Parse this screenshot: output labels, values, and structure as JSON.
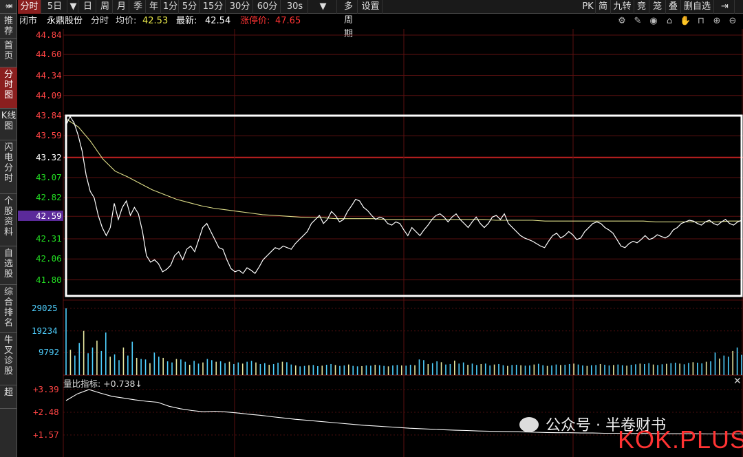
{
  "left_nav": {
    "expand_glyph": "»",
    "items": [
      {
        "label": "推荐",
        "active": false
      },
      {
        "label": "首页",
        "active": false
      },
      {
        "label": "分时图",
        "active": true
      },
      {
        "label": "K线图",
        "active": false
      },
      {
        "label": "闪电分时",
        "active": false
      },
      {
        "label": "个股资料",
        "active": false
      },
      {
        "label": "自选股",
        "active": false
      },
      {
        "label": "综合排名",
        "active": false
      },
      {
        "label": "牛叉诊股",
        "active": false
      },
      {
        "label": "超",
        "active": false
      }
    ]
  },
  "toolbar": {
    "left": [
      {
        "label": "分时",
        "active": true
      },
      {
        "label": "5日",
        "active": false
      },
      {
        "label": "▼",
        "active": false
      },
      {
        "label": "日",
        "active": false
      },
      {
        "label": "周",
        "active": false
      },
      {
        "label": "月",
        "active": false
      },
      {
        "label": "季",
        "active": false
      },
      {
        "label": "年",
        "active": false
      },
      {
        "label": "1分",
        "active": false
      },
      {
        "label": "5分",
        "active": false
      },
      {
        "label": "15分",
        "active": false
      },
      {
        "label": "30分",
        "active": false
      },
      {
        "label": "60分",
        "active": false
      },
      {
        "label": "30s",
        "active": false
      },
      {
        "label": "▼",
        "active": false
      },
      {
        "label": "多周期",
        "active": false
      },
      {
        "label": "设置",
        "active": false
      }
    ],
    "right": [
      "PK",
      "简",
      "九转",
      "竞",
      "笼",
      "叠",
      "删自选"
    ]
  },
  "info": {
    "status": "闭市",
    "name": "永鼎股份",
    "view": "分时",
    "avg_label": "均价:",
    "avg_value": "42.53",
    "last_label": "最新:",
    "last_value": "42.54",
    "limit_label": "涨停价:",
    "limit_value": "47.65"
  },
  "header_icons": [
    "settings-icon",
    "pen-icon",
    "eye-icon",
    "basket-icon",
    "hand-icon",
    "lock-icon",
    "zoom-in-icon",
    "zoom-out-icon"
  ],
  "price_axis": {
    "labels": [
      {
        "text": "44.84",
        "color": "#ff4444"
      },
      {
        "text": "44.60",
        "color": "#ff4444"
      },
      {
        "text": "44.34",
        "color": "#ff4444"
      },
      {
        "text": "44.09",
        "color": "#ff4444"
      },
      {
        "text": "43.84",
        "color": "#ff4444"
      },
      {
        "text": "43.59",
        "color": "#ff4444"
      },
      {
        "text": "43.32",
        "color": "#ffffff"
      },
      {
        "text": "43.07",
        "color": "#22dd22"
      },
      {
        "text": "42.82",
        "color": "#22dd22"
      },
      {
        "text": "42.59",
        "color": "#ffffff"
      },
      {
        "text": "42.31",
        "color": "#22dd22"
      },
      {
        "text": "42.06",
        "color": "#22dd22"
      },
      {
        "text": "41.80",
        "color": "#22dd22"
      }
    ],
    "highlight": "42.59"
  },
  "volume_axis": [
    "29025",
    "19234",
    "9792"
  ],
  "ratio_indicator": {
    "label": "量比指标: +0.738↓",
    "axis": [
      "+3.39",
      "+2.48",
      "+1.57"
    ]
  },
  "watermark": {
    "brand": "公众号 · 半卷财书",
    "site": "KOK.PLUS"
  },
  "chart_data": {
    "type": "line",
    "title": "",
    "y_range": [
      41.6,
      44.9
    ],
    "price": [
      43.72,
      43.83,
      43.75,
      43.6,
      43.4,
      43.1,
      42.9,
      42.82,
      42.6,
      42.45,
      42.35,
      42.45,
      42.75,
      42.55,
      42.7,
      42.78,
      42.6,
      42.7,
      42.62,
      42.4,
      42.1,
      42.02,
      42.05,
      42.0,
      41.9,
      41.93,
      41.98,
      42.1,
      42.15,
      42.05,
      42.18,
      42.22,
      42.15,
      42.3,
      42.45,
      42.5,
      42.4,
      42.3,
      42.2,
      42.18,
      42.05,
      41.94,
      41.9,
      41.92,
      41.88,
      41.95,
      41.92,
      41.88,
      41.96,
      42.05,
      42.1,
      42.15,
      42.2,
      42.18,
      42.22,
      42.2,
      42.18,
      42.25,
      42.3,
      42.35,
      42.4,
      42.5,
      42.55,
      42.6,
      42.5,
      42.55,
      42.65,
      42.6,
      42.52,
      42.55,
      42.65,
      42.72,
      42.8,
      42.78,
      42.7,
      42.66,
      42.6,
      42.55,
      42.58,
      42.56,
      42.5,
      42.48,
      42.52,
      42.5,
      42.42,
      42.35,
      42.45,
      42.4,
      42.35,
      42.42,
      42.48,
      42.55,
      42.6,
      42.62,
      42.58,
      42.52,
      42.58,
      42.62,
      42.55,
      42.5,
      42.45,
      42.52,
      42.58,
      42.5,
      42.45,
      42.5,
      42.58,
      42.6,
      42.55,
      42.62,
      42.5,
      42.45,
      42.4,
      42.35,
      42.32,
      42.3,
      42.28,
      42.25,
      42.22,
      42.2,
      42.28,
      42.35,
      42.38,
      42.32,
      42.35,
      42.4,
      42.36,
      42.3,
      42.32,
      42.4,
      42.45,
      42.5,
      42.52,
      42.5,
      42.45,
      42.42,
      42.38,
      42.3,
      42.22,
      42.2,
      42.25,
      42.28,
      42.26,
      42.3,
      42.35,
      42.3,
      42.32,
      42.36,
      42.34,
      42.32,
      42.35,
      42.42,
      42.45,
      42.5,
      42.52,
      42.54,
      42.53,
      42.5,
      42.48,
      42.52,
      42.54,
      42.5,
      42.48,
      42.52,
      42.55,
      42.5,
      42.48,
      42.52,
      42.54
    ],
    "average": [
      43.8,
      43.7,
      43.52,
      43.3,
      43.15,
      43.08,
      43.0,
      42.92,
      42.86,
      42.8,
      42.76,
      42.72,
      42.69,
      42.67,
      42.65,
      42.63,
      42.61,
      42.6,
      42.59,
      42.58,
      42.57,
      42.57,
      42.56,
      42.56,
      42.56,
      42.56,
      42.55,
      42.55,
      42.55,
      42.55,
      42.55,
      42.55,
      42.55,
      42.55,
      42.55,
      42.54,
      42.54,
      42.54,
      42.54,
      42.53,
      42.53,
      42.53,
      42.53,
      42.53,
      42.53,
      42.53,
      42.53,
      42.53,
      42.52,
      42.52,
      42.52,
      42.52,
      42.52,
      42.52,
      42.53,
      42.53
    ],
    "volume": [
      29025,
      11000,
      8500,
      14000,
      19234,
      9500,
      12000,
      15000,
      10500,
      18500,
      8000,
      9000,
      6500,
      12000,
      8500,
      14500,
      7500,
      7000,
      6800,
      5200,
      9800,
      8000,
      7500,
      6000,
      5500,
      7000,
      6800,
      5800,
      4500,
      6200,
      5000,
      5500,
      7000,
      6500,
      5800,
      6000,
      5200,
      5800,
      4800,
      5500,
      5000,
      5800,
      6200,
      5500,
      4800,
      5200,
      4500,
      4800,
      5400,
      5800,
      5600,
      4600,
      4200,
      3800,
      4000,
      4300,
      4400,
      3900,
      4100,
      4500,
      4800,
      4400,
      4000,
      4200,
      4600,
      4000,
      3800,
      3900,
      4200,
      4100,
      4500,
      4300,
      4000,
      3800,
      4200,
      4400,
      4200,
      4100,
      4500,
      4300,
      6800,
      6500,
      4800,
      5200,
      6000,
      5600,
      4600,
      4800,
      6300,
      5000,
      5500,
      4500,
      5000,
      4400,
      4800,
      5000,
      4200,
      4600,
      4800,
      4300,
      4000,
      4400,
      4500,
      4300,
      4100,
      4200,
      4600,
      4900,
      4300,
      4000,
      4200,
      4600,
      4400,
      4500,
      4800,
      5000,
      4600,
      4200,
      4000,
      4300,
      4400,
      4800,
      4500,
      4200,
      4400,
      4600,
      4300,
      4100,
      4500,
      4700,
      5000,
      4800,
      5200,
      4600,
      4400,
      4700,
      4900,
      5200,
      5400,
      5000,
      4700,
      5300,
      5600,
      5400,
      5100,
      5800,
      6000,
      9800,
      7200,
      8500,
      8000,
      10500,
      12000,
      8800
    ],
    "ratio": [
      2.95,
      3.22,
      3.39,
      3.25,
      3.12,
      3.05,
      2.98,
      2.92,
      2.88,
      2.72,
      2.62,
      2.55,
      2.5,
      2.52,
      2.49,
      2.45,
      2.4,
      2.36,
      2.3,
      2.25,
      2.2,
      2.16,
      2.12,
      2.08,
      2.04,
      2.0,
      1.96,
      1.93,
      1.9,
      1.87,
      1.84,
      1.82,
      1.8,
      1.78,
      1.76,
      1.75,
      1.73,
      1.72,
      1.71,
      1.7,
      1.69,
      1.68,
      1.67,
      1.66,
      1.66,
      1.65,
      1.65,
      1.64,
      1.64,
      1.63,
      1.63,
      1.63,
      1.62,
      1.62,
      1.62,
      1.62,
      1.61,
      1.61,
      1.61,
      1.61
    ]
  }
}
